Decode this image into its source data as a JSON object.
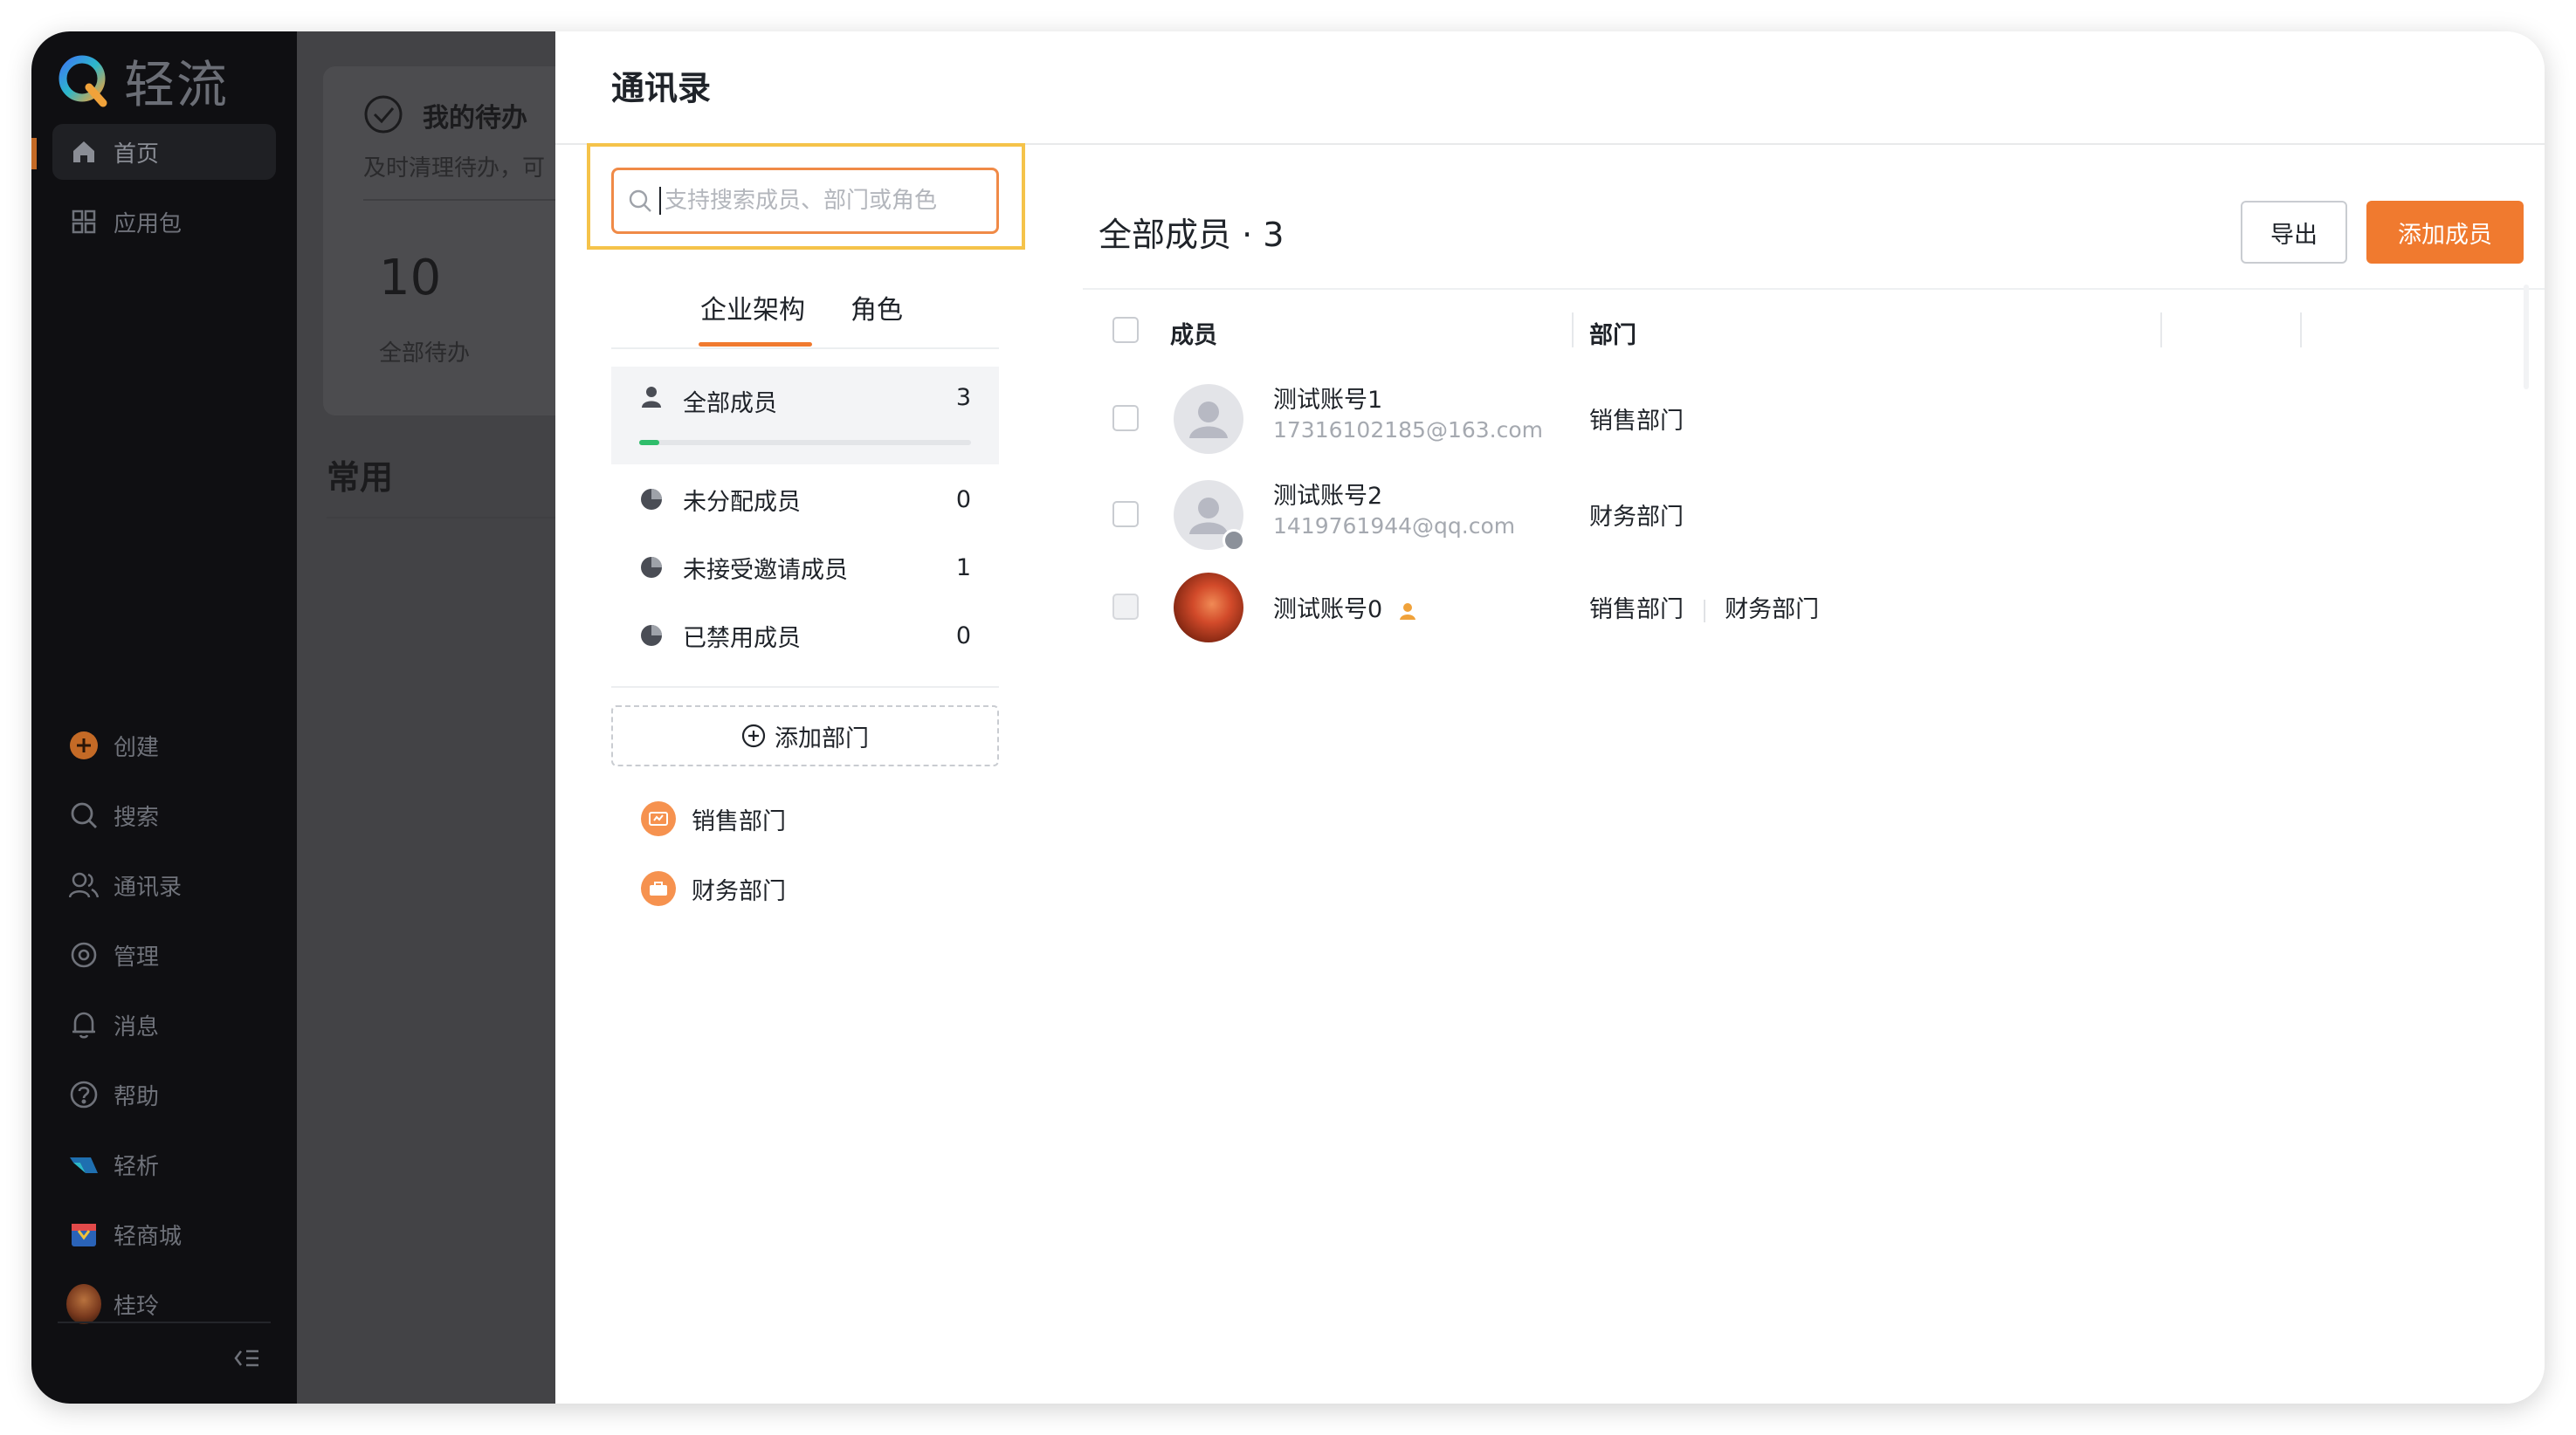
{
  "sidebar": {
    "app_name": "轻流",
    "items": [
      {
        "label": "首页",
        "icon": "home-icon"
      },
      {
        "label": "应用包",
        "icon": "grid-icon"
      },
      {
        "label": "创建",
        "icon": "plus-circle-icon"
      },
      {
        "label": "搜索",
        "icon": "search-icon"
      },
      {
        "label": "通讯录",
        "icon": "contacts-icon"
      },
      {
        "label": "管理",
        "icon": "settings-icon"
      },
      {
        "label": "消息",
        "icon": "bell-icon"
      },
      {
        "label": "帮助",
        "icon": "help-icon"
      },
      {
        "label": "轻析",
        "icon": "analytics-icon"
      },
      {
        "label": "轻商城",
        "icon": "store-icon"
      },
      {
        "label": "桂玲",
        "icon": "user-avatar"
      }
    ]
  },
  "home": {
    "todo_title": "我的待办",
    "todo_sub": "及时清理待办，可",
    "todo_count": "10",
    "todo_count_label": "全部待办",
    "common_title": "常用"
  },
  "contacts": {
    "title": "通讯录",
    "search_placeholder": "支持搜索成员、部门或角色",
    "tabs": [
      "企业架构",
      "角色"
    ],
    "groups": [
      {
        "label": "全部成员",
        "count": "3",
        "progress": 0.06
      },
      {
        "label": "未分配成员",
        "count": "0"
      },
      {
        "label": "未接受邀请成员",
        "count": "1"
      },
      {
        "label": "已禁用成员",
        "count": "0"
      }
    ],
    "add_department_label": "添加部门",
    "departments": [
      "销售部门",
      "财务部门"
    ],
    "list_title": "全部成员 · 3",
    "export_label": "导出",
    "add_member_label": "添加成员",
    "columns": {
      "member": "成员",
      "department": "部门"
    },
    "members": [
      {
        "name": "测试账号1",
        "email": "17316102185@163.com",
        "departments": [
          "销售部门"
        ]
      },
      {
        "name": "测试账号2",
        "email": "1419761944@qq.com",
        "departments": [
          "财务部门"
        ]
      },
      {
        "name": "测试账号0",
        "email": "",
        "departments": [
          "销售部门",
          "财务部门"
        ]
      }
    ]
  },
  "colors": {
    "accent": "#f07a2f",
    "highlight": "#f5c34a",
    "sidebar_bg": "#0f0f12",
    "progress": "#2fbd6b"
  }
}
